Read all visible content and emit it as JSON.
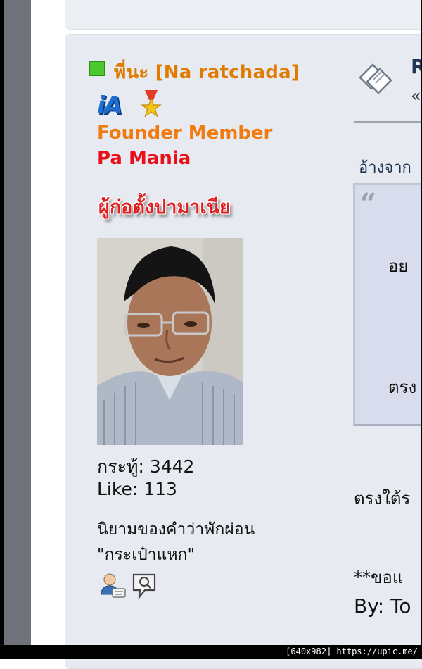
{
  "post": {
    "author": {
      "status": "online",
      "display_name": "พี่นะ [Na ratchada]",
      "rank_icon": "ia-logo-icon",
      "badge_icon": "star-medal-icon",
      "group_title": "Founder Member",
      "secondary_title": "Pa Mania",
      "banner_text": "ผู้ก่อตั้งปามาเนีย",
      "posts_label": "กระทู้: 3442",
      "likes_label": "Like: 113",
      "signature_line1": "นิยามของคำว่าพักผ่อน",
      "signature_line2": "\"กระเป๋าแหก\"",
      "profile_icon": "profile-icon",
      "message_icon": "message-icon"
    },
    "content": {
      "topic_icon": "topic-icon",
      "title_partial": "R",
      "title_sub": "«",
      "quote_header": "อ้างจาก",
      "quote_lines": [
        "อย",
        "ตรง"
      ],
      "body_lines": [
        "ตรงใต้ร",
        "**ขอแ",
        "By: To"
      ]
    }
  },
  "watermark": "[640x982] https://upic.me/",
  "colors": {
    "username": "#e07b00",
    "founder": "#f07c10",
    "pamania": "#e8101a",
    "post_bg": "#e7eaf0",
    "quote_bg": "#d8dcec",
    "online": "#4cc72e"
  }
}
